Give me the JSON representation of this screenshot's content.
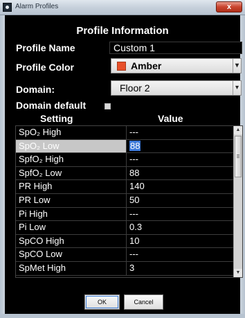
{
  "window": {
    "title": "Alarm Profiles",
    "close_label": "x"
  },
  "section_title": "Profile Information",
  "profile_name": {
    "label": "Profile Name",
    "value": "Custom 1"
  },
  "profile_color": {
    "label": "Profile Color",
    "value": "Amber",
    "swatch_color": "#e8502a"
  },
  "domain": {
    "label": "Domain:",
    "value": "Floor 2"
  },
  "domain_default": {
    "label": "Domain default",
    "checked": false
  },
  "table": {
    "headers": [
      "Setting",
      "Value"
    ],
    "rows": [
      {
        "setting": "SpO₂ High",
        "value": "---"
      },
      {
        "setting": "SpO₂ Low",
        "value": "88",
        "selected": true
      },
      {
        "setting": "SpfO₂ High",
        "value": "---"
      },
      {
        "setting": "SpfO₂ Low",
        "value": "88"
      },
      {
        "setting": "PR High",
        "value": "140"
      },
      {
        "setting": "PR Low",
        "value": "50"
      },
      {
        "setting": "Pi High",
        "value": "---"
      },
      {
        "setting": "Pi Low",
        "value": "0.3"
      },
      {
        "setting": "SpCO High",
        "value": "10"
      },
      {
        "setting": "SpCO Low",
        "value": "---"
      },
      {
        "setting": "SpMet High",
        "value": "3"
      }
    ]
  },
  "buttons": {
    "ok": "OK",
    "cancel": "Cancel"
  },
  "icons": {
    "app": "app-icon",
    "dropdown": "chevron-down-icon",
    "scroll_up": "up-arrow-icon",
    "scroll_down": "down-arrow-icon"
  }
}
